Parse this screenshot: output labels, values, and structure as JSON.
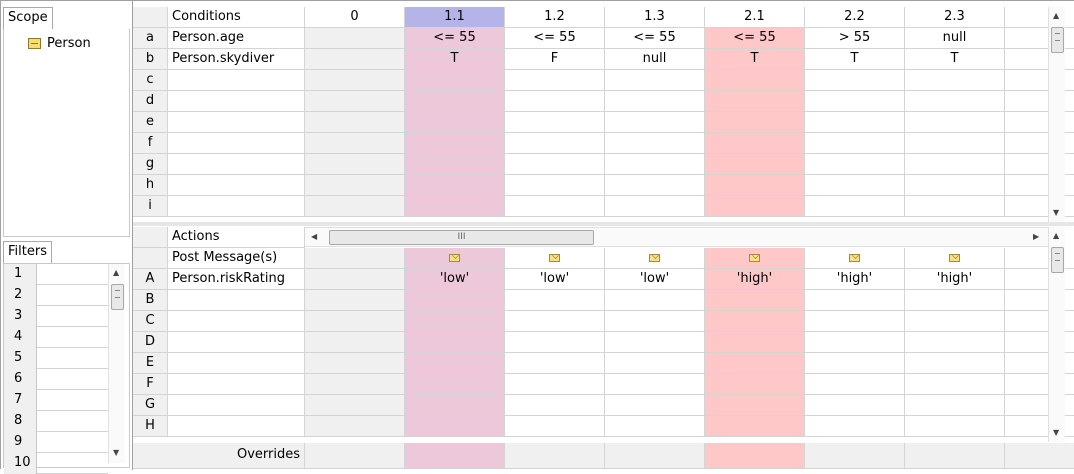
{
  "scope": {
    "tab_label": "Scope",
    "tree": [
      {
        "label": "Person",
        "icon": "package-icon"
      }
    ]
  },
  "filters": {
    "tab_label": "Filters",
    "rows": [
      "1",
      "2",
      "3",
      "4",
      "5",
      "6",
      "7",
      "8",
      "9",
      "10"
    ]
  },
  "conditions": {
    "header_label": "Conditions",
    "columns": [
      "0",
      "1.1",
      "1.2",
      "1.3",
      "2.1",
      "2.2",
      "2.3",
      ""
    ],
    "rows": [
      {
        "id": "a",
        "label": "Person.age",
        "values": [
          "",
          "<= 55",
          "<= 55",
          "<= 55",
          "<= 55",
          "> 55",
          "null",
          ""
        ]
      },
      {
        "id": "b",
        "label": "Person.skydiver",
        "values": [
          "",
          "T",
          "F",
          "null",
          "T",
          "T",
          "T",
          ""
        ]
      },
      {
        "id": "c",
        "label": "",
        "values": [
          "",
          "",
          "",
          "",
          "",
          "",
          "",
          ""
        ]
      },
      {
        "id": "d",
        "label": "",
        "values": [
          "",
          "",
          "",
          "",
          "",
          "",
          "",
          ""
        ]
      },
      {
        "id": "e",
        "label": "",
        "values": [
          "",
          "",
          "",
          "",
          "",
          "",
          "",
          ""
        ]
      },
      {
        "id": "f",
        "label": "",
        "values": [
          "",
          "",
          "",
          "",
          "",
          "",
          "",
          ""
        ]
      },
      {
        "id": "g",
        "label": "",
        "values": [
          "",
          "",
          "",
          "",
          "",
          "",
          "",
          ""
        ]
      },
      {
        "id": "h",
        "label": "",
        "values": [
          "",
          "",
          "",
          "",
          "",
          "",
          "",
          ""
        ]
      },
      {
        "id": "i",
        "label": "",
        "values": [
          "",
          "",
          "",
          "",
          "",
          "",
          "",
          ""
        ]
      }
    ]
  },
  "actions": {
    "header_label": "Actions",
    "post_message_label": "Post Message(s)",
    "rows": [
      {
        "id": "A",
        "label": "Person.riskRating",
        "values": [
          "",
          "'low'",
          "'low'",
          "'low'",
          "'high'",
          "'high'",
          "'high'",
          ""
        ]
      },
      {
        "id": "B",
        "label": "",
        "values": [
          "",
          "",
          "",
          "",
          "",
          "",
          "",
          ""
        ]
      },
      {
        "id": "C",
        "label": "",
        "values": [
          "",
          "",
          "",
          "",
          "",
          "",
          "",
          ""
        ]
      },
      {
        "id": "D",
        "label": "",
        "values": [
          "",
          "",
          "",
          "",
          "",
          "",
          "",
          ""
        ]
      },
      {
        "id": "E",
        "label": "",
        "values": [
          "",
          "",
          "",
          "",
          "",
          "",
          "",
          ""
        ]
      },
      {
        "id": "F",
        "label": "",
        "values": [
          "",
          "",
          "",
          "",
          "",
          "",
          "",
          ""
        ]
      },
      {
        "id": "G",
        "label": "",
        "values": [
          "",
          "",
          "",
          "",
          "",
          "",
          "",
          ""
        ]
      },
      {
        "id": "H",
        "label": "",
        "values": [
          "",
          "",
          "",
          "",
          "",
          "",
          "",
          ""
        ]
      }
    ],
    "overrides_label": "Overrides"
  },
  "hscroll_thumb_label": "III",
  "colors": {
    "selected_header": "#b4b4e8",
    "col_1_1": "#ecc8da",
    "col_2_1": "#ffc8c8",
    "gray": "#f0f0f0"
  }
}
